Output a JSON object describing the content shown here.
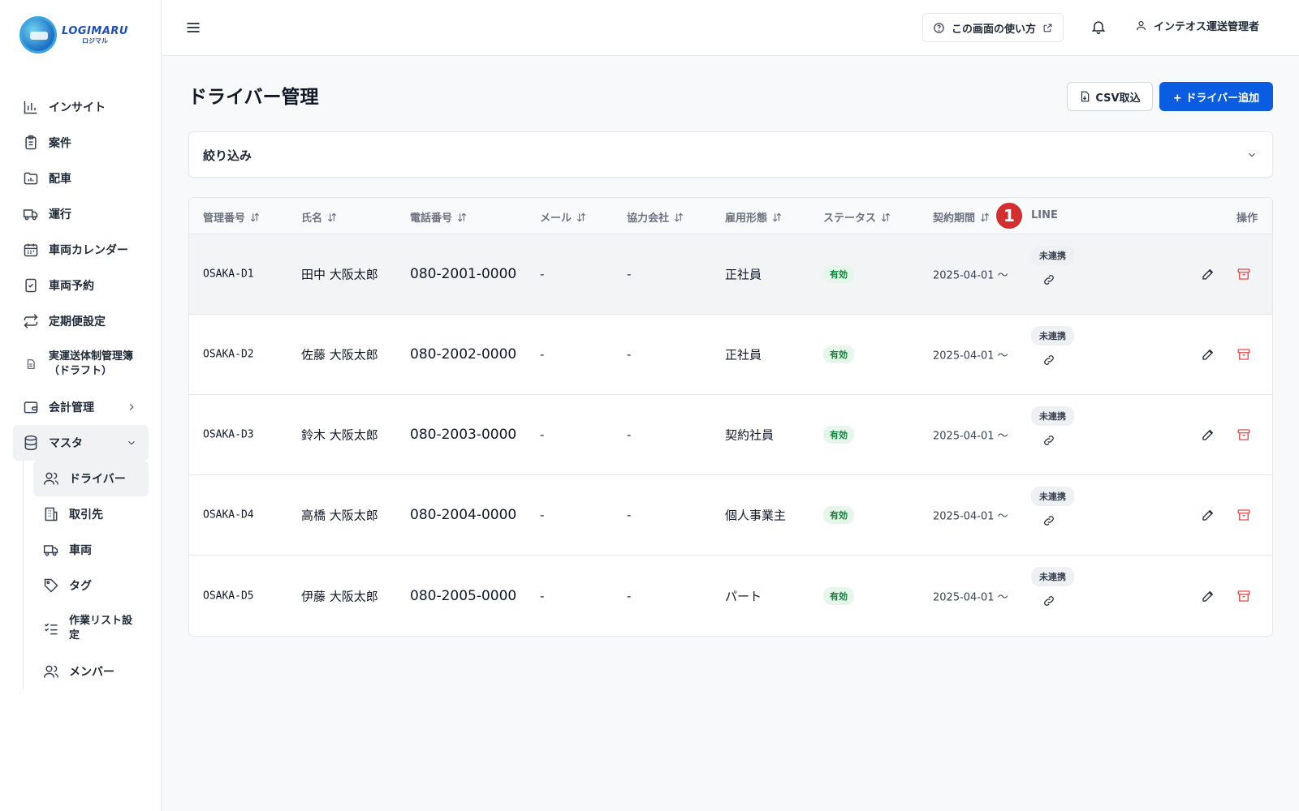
{
  "brand": {
    "name": "LOGIMARU",
    "sub": "ロジマル"
  },
  "sidebar": {
    "items": [
      {
        "label": "インサイト",
        "icon": "bar-chart-icon"
      },
      {
        "label": "案件",
        "icon": "clipboard-icon"
      },
      {
        "label": "配車",
        "icon": "folder-chart-icon"
      },
      {
        "label": "運行",
        "icon": "truck-icon"
      },
      {
        "label": "車両カレンダー",
        "icon": "calendar-icon"
      },
      {
        "label": "車両予約",
        "icon": "clipboard-check-icon"
      },
      {
        "label": "定期便設定",
        "icon": "repeat-icon"
      },
      {
        "label": "実運送体制管理簿",
        "label2": "（ドラフト）",
        "icon": "document-icon"
      },
      {
        "label": "会計管理",
        "icon": "wallet-icon"
      },
      {
        "label": "マスタ",
        "icon": "database-icon"
      }
    ],
    "sub_items": [
      {
        "label": "ドライバー",
        "icon": "users-icon"
      },
      {
        "label": "取引先",
        "icon": "building-icon"
      },
      {
        "label": "車両",
        "icon": "truck-icon"
      },
      {
        "label": "タグ",
        "icon": "tag-icon"
      },
      {
        "label": "作業リスト設",
        "label2": "定",
        "icon": "list-check-icon"
      },
      {
        "label": "メンバー",
        "icon": "users-icon"
      }
    ]
  },
  "header": {
    "help_label": "この画面の使い方",
    "user_name": "インテオス運送管理者"
  },
  "page": {
    "title": "ドライバー管理",
    "csv_label": "CSV取込",
    "add_label": "+ ドライバー追加",
    "filter_label": "絞り込み"
  },
  "table": {
    "columns": [
      "管理番号",
      "氏名",
      "電話番号",
      "メール",
      "協力会社",
      "雇用形態",
      "ステータス",
      "契約期間",
      "LINE",
      "操作"
    ],
    "rows": [
      {
        "id": "OSAKA-D1",
        "name": "田中 大阪太郎",
        "phone": "080-2001-0000",
        "mail": "-",
        "company": "-",
        "employment": "正社員",
        "status": "有効",
        "period": "2025-04-01 ～",
        "line": "未連携"
      },
      {
        "id": "OSAKA-D2",
        "name": "佐藤 大阪太郎",
        "phone": "080-2002-0000",
        "mail": "-",
        "company": "-",
        "employment": "正社員",
        "status": "有効",
        "period": "2025-04-01 ～",
        "line": "未連携"
      },
      {
        "id": "OSAKA-D3",
        "name": "鈴木 大阪太郎",
        "phone": "080-2003-0000",
        "mail": "-",
        "company": "-",
        "employment": "契約社員",
        "status": "有効",
        "period": "2025-04-01 ～",
        "line": "未連携"
      },
      {
        "id": "OSAKA-D4",
        "name": "高橋 大阪太郎",
        "phone": "080-2004-0000",
        "mail": "-",
        "company": "-",
        "employment": "個人事業主",
        "status": "有効",
        "period": "2025-04-01 ～",
        "line": "未連携"
      },
      {
        "id": "OSAKA-D5",
        "name": "伊藤 大阪太郎",
        "phone": "080-2005-0000",
        "mail": "-",
        "company": "-",
        "employment": "パート",
        "status": "有効",
        "period": "2025-04-01 ～",
        "line": "未連携"
      }
    ]
  },
  "annotation": {
    "marker": "1"
  },
  "colors": {
    "primary": "#0a5ce0",
    "danger": "#ef4444",
    "active_badge": "#15803d",
    "marker": "#d32f2f"
  }
}
